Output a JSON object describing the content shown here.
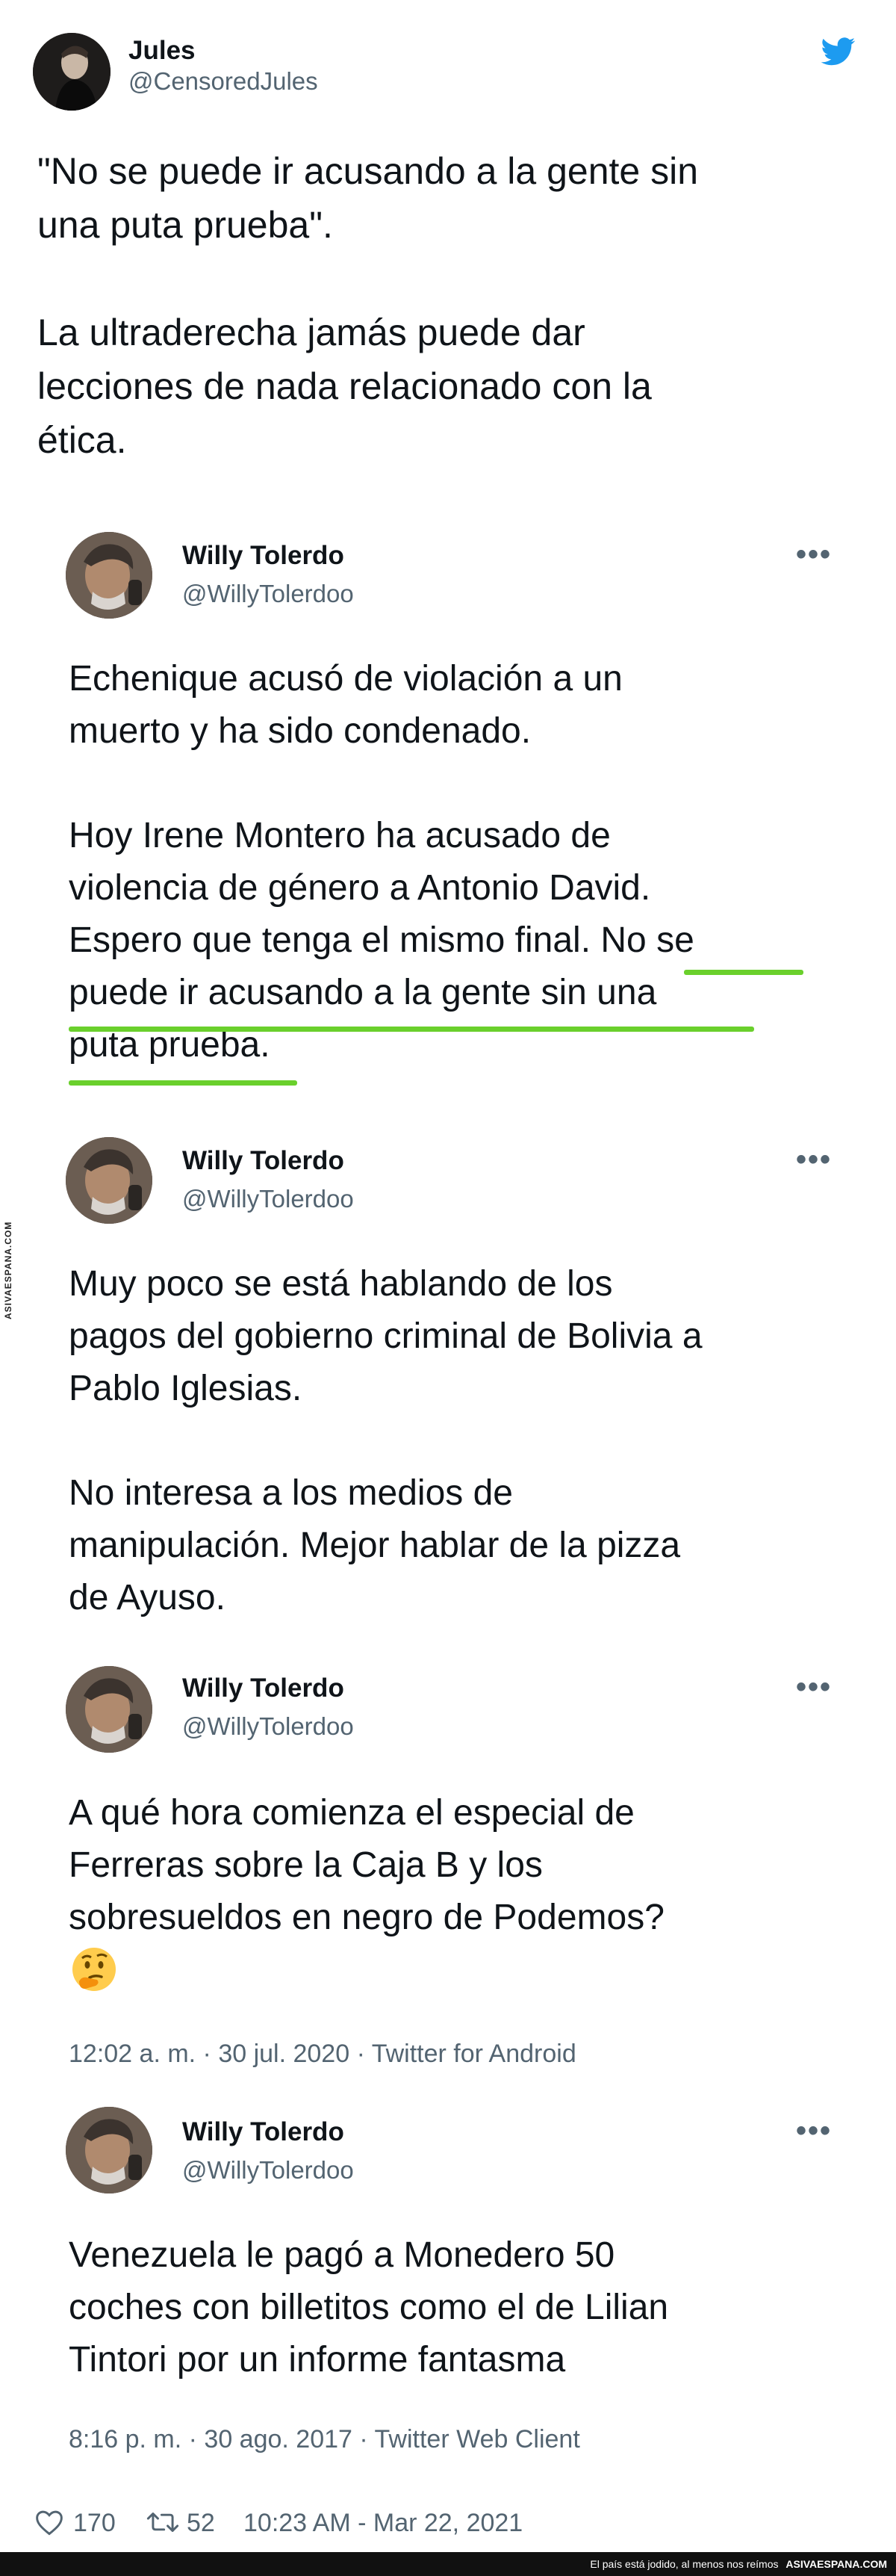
{
  "outer_tweet": {
    "display_name": "Jules",
    "handle": "@CensoredJules",
    "text_lines": [
      "\"No se puede ir acusando a la gente sin",
      "una puta prueba\".",
      "",
      "La ultraderecha jamás puede dar",
      "lecciones de nada relacionado con la",
      "ética."
    ],
    "likes": "170",
    "retweets": "52",
    "timestamp": "10:23 AM - Mar 22, 2021"
  },
  "quoted_tweets": [
    {
      "display_name": "Willy Tolerdo",
      "handle": "@WillyTolerdoo",
      "text_lines": [
        "Echenique acusó de violación a un",
        "muerto y ha sido condenado.",
        "",
        "Hoy Irene Montero ha acusado de",
        "violencia de género a Antonio David.",
        "Espero que tenga el mismo final. No se",
        "puede ir acusando a la gente sin una",
        "puta prueba."
      ],
      "meta": ""
    },
    {
      "display_name": "Willy Tolerdo",
      "handle": "@WillyTolerdoo",
      "text_lines": [
        "Muy poco se está hablando de los",
        "pagos del gobierno criminal de Bolivia a",
        "Pablo Iglesias.",
        "",
        "No interesa a los medios de",
        "manipulación. Mejor hablar de la pizza",
        "de Ayuso."
      ],
      "meta": ""
    },
    {
      "display_name": "Willy Tolerdo",
      "handle": "@WillyTolerdoo",
      "text_lines": [
        "A qué hora comienza el especial de",
        "Ferreras sobre la Caja B y los",
        "sobresueldos en negro de Podemos?"
      ],
      "emoji": "🤔",
      "meta": "12:02 a. m. · 30 jul. 2020 · Twitter for Android"
    },
    {
      "display_name": "Willy Tolerdo",
      "handle": "@WillyTolerdoo",
      "text_lines": [
        "Venezuela le pagó a Monedero 50",
        "coches con billetitos como el de Lilian",
        "Tintori por un informe fantasma"
      ],
      "meta": "8:16 p. m. · 30 ago. 2017 · Twitter Web Client"
    }
  ],
  "more_label": "•••",
  "watermark": {
    "side": "ASIVAESPANA.COM",
    "footer_text": "El país está jodido, al menos nos reímos",
    "footer_brand": "ASIVAESPANA.COM"
  },
  "colors": {
    "twitter_blue": "#1d9bf0",
    "underline_green": "#6ad02c",
    "secondary_text": "#536471"
  },
  "icons": [
    "twitter-bird-icon",
    "more-icon",
    "heart-icon",
    "retweet-icon",
    "thinking-face-emoji"
  ]
}
